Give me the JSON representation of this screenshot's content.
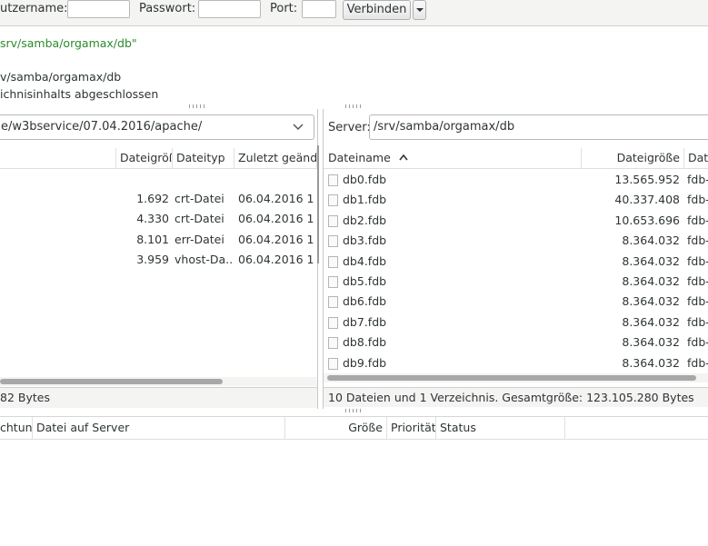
{
  "quickconnect": {
    "user_label": "utzername:",
    "pass_label": "Passwort:",
    "port_label": "Port:",
    "connect_label": "Verbinden"
  },
  "log": {
    "lines": [
      {
        "text": "srv/samba/orgamax/db\"",
        "color": "#2b8a2b"
      },
      {
        "text": "v/samba/orgamax/db",
        "color": "#2e3436"
      },
      {
        "text": "ichnisinhalts abgeschlossen",
        "color": "#2e3436"
      }
    ]
  },
  "local": {
    "path": "e/w3bservice/07.04.2016/apache/",
    "columns": [
      "Dateigröß",
      "Dateityp",
      "Zuletzt geänd"
    ],
    "rows": [
      {
        "size": "1.692",
        "type": "crt-Datei",
        "date": "06.04.2016 1"
      },
      {
        "size": "4.330",
        "type": "crt-Datei",
        "date": "06.04.2016 1"
      },
      {
        "size": "8.101",
        "type": "err-Datei",
        "date": "06.04.2016 1"
      },
      {
        "size": "3.959",
        "type": "vhost-Da...",
        "date": "06.04.2016 1"
      }
    ],
    "status": "82 Bytes"
  },
  "remote": {
    "server_label": "Server:",
    "path": "/srv/samba/orgamax/db",
    "columns": [
      "Dateiname",
      "Dateigröße",
      "Dat"
    ],
    "rows": [
      {
        "name": "db0.fdb",
        "size": "13.565.952",
        "type": "fdb-"
      },
      {
        "name": "db1.fdb",
        "size": "40.337.408",
        "type": "fdb-"
      },
      {
        "name": "db2.fdb",
        "size": "10.653.696",
        "type": "fdb-"
      },
      {
        "name": "db3.fdb",
        "size": "8.364.032",
        "type": "fdb-"
      },
      {
        "name": "db4.fdb",
        "size": "8.364.032",
        "type": "fdb-"
      },
      {
        "name": "db5.fdb",
        "size": "8.364.032",
        "type": "fdb-"
      },
      {
        "name": "db6.fdb",
        "size": "8.364.032",
        "type": "fdb-"
      },
      {
        "name": "db7.fdb",
        "size": "8.364.032",
        "type": "fdb-"
      },
      {
        "name": "db8.fdb",
        "size": "8.364.032",
        "type": "fdb-"
      },
      {
        "name": "db9.fdb",
        "size": "8.364.032",
        "type": "fdb-"
      }
    ],
    "status": "10 Dateien und 1 Verzeichnis. Gesamtgröße: 123.105.280 Bytes"
  },
  "queue": {
    "columns": [
      "chtunç",
      "Datei auf Server",
      "Größe",
      "Priorität",
      "Status"
    ]
  }
}
